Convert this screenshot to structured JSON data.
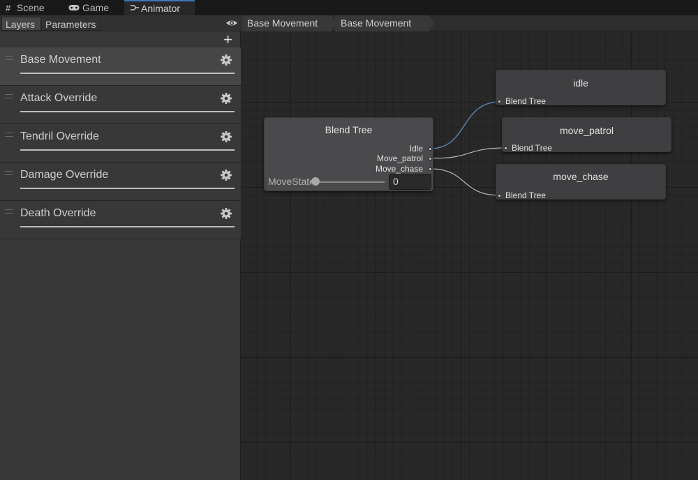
{
  "tabs": [
    {
      "label": "Scene",
      "icon": "grid-icon"
    },
    {
      "label": "Game",
      "icon": "gamepad-icon"
    },
    {
      "label": "Animator",
      "icon": "animator-icon"
    }
  ],
  "left_panel": {
    "subtabs": [
      "Layers",
      "Parameters"
    ],
    "add_label": "+",
    "layers": [
      {
        "name": "Base Movement",
        "selected": true
      },
      {
        "name": "Attack Override"
      },
      {
        "name": "Tendril Override"
      },
      {
        "name": "Damage Override"
      },
      {
        "name": "Death Override"
      }
    ]
  },
  "breadcrumb": [
    "Base Movement",
    "Base Movement"
  ],
  "graph": {
    "blend_tree": {
      "title": "Blend Tree",
      "outputs": [
        "Idle",
        "Move_patrol",
        "Move_chase"
      ],
      "param_label": "MoveState",
      "param_value": "0"
    },
    "states": [
      {
        "title": "idle",
        "input": "Blend Tree"
      },
      {
        "title": "move_patrol",
        "input": "Blend Tree"
      },
      {
        "title": "move_chase",
        "input": "Blend Tree"
      }
    ]
  },
  "colors": {
    "active_tab_accent": "#3a79bb",
    "selected_wire": "#5a7fb3"
  }
}
